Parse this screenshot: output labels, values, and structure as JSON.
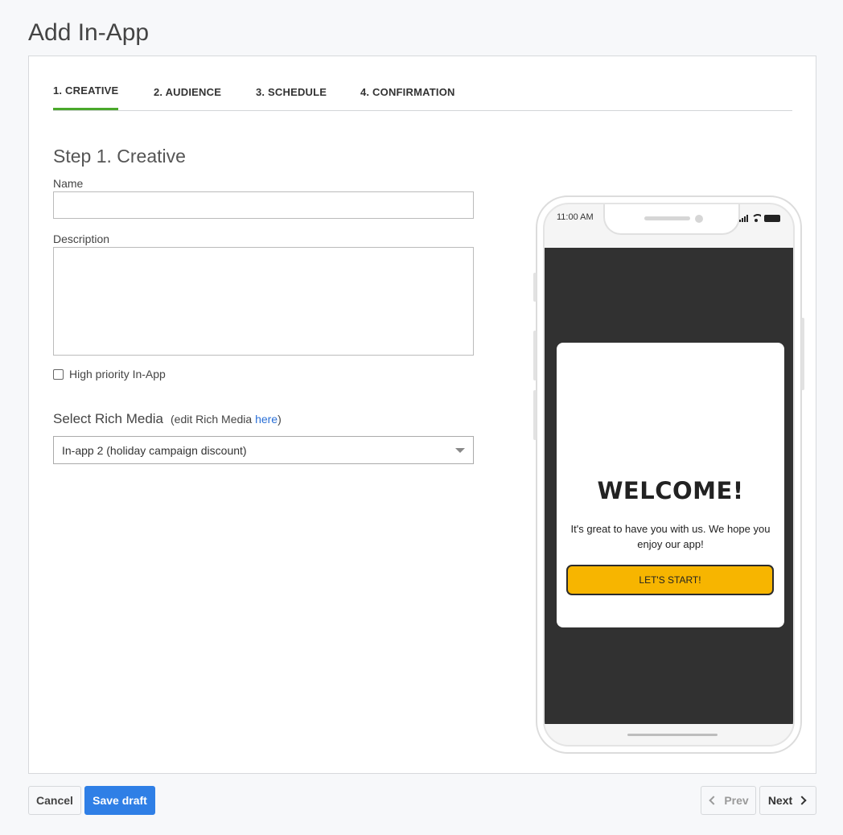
{
  "page": {
    "title": "Add In-App"
  },
  "tabs": [
    {
      "label": "1. CREATIVE",
      "active": true
    },
    {
      "label": "2. AUDIENCE",
      "active": false
    },
    {
      "label": "3. SCHEDULE",
      "active": false
    },
    {
      "label": "4. CONFIRMATION",
      "active": false
    }
  ],
  "form": {
    "step_title": "Step 1. Creative",
    "name_label": "Name",
    "name_value": "",
    "description_label": "Description",
    "description_value": "",
    "high_priority_label": "High priority In-App",
    "high_priority_checked": false,
    "rich_media_label": "Select Rich Media",
    "edit_prefix": "(edit Rich Media ",
    "edit_link": "here",
    "edit_suffix": ")",
    "rich_media_selected": "In-app 2 (holiday campaign discount)"
  },
  "preview": {
    "status_time": "11:00 AM",
    "modal_title": "WELCOME!",
    "modal_body": "It's great to have you with us. We hope you enjoy our app!",
    "modal_button": "LET'S START!",
    "screen_color": "#313131",
    "button_color": "#f7b500"
  },
  "footer": {
    "cancel": "Cancel",
    "save_draft": "Save draft",
    "prev": "Prev",
    "next": "Next"
  },
  "colors": {
    "accent_tab": "#4aa82b",
    "primary_button": "#2f7fe6",
    "link": "#2a6fd6"
  }
}
